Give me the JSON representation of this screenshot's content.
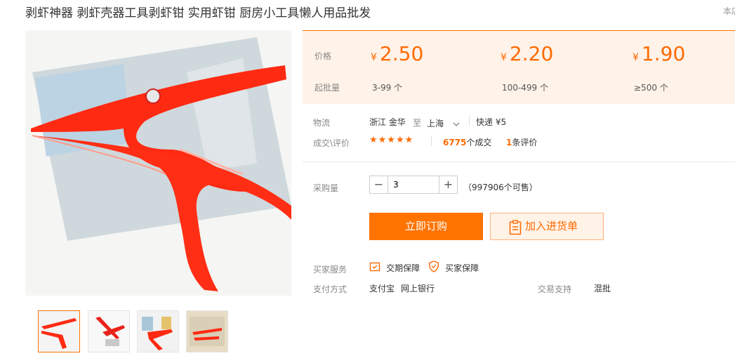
{
  "title": "剥虾神器 剥虾壳器工具剥虾钳 实用虾钳 厨房小工具懒人用品批发",
  "corner_text": "本店",
  "colors": {
    "accent": "#ff7300",
    "price": "#ff6a00",
    "price_bg": "#fff2e8"
  },
  "price_table": {
    "price_label": "价格",
    "moq_label": "起批量",
    "currency": "¥",
    "tiers": [
      {
        "price": "2.50",
        "range": "3-99 个"
      },
      {
        "price": "2.20",
        "range": "100-499 个"
      },
      {
        "price": "1.90",
        "range": "≥500 个"
      }
    ]
  },
  "logistics": {
    "label": "物流",
    "origin": "浙江 金华",
    "to": "至",
    "destination": "上海",
    "shipping": "快递 ¥5"
  },
  "deals": {
    "label": "成交\\评价",
    "stars": "★★★★★",
    "sold_count": "6775",
    "sold_suffix": "个成交",
    "review_count": "1",
    "review_suffix": "条评价"
  },
  "purchase": {
    "label": "采购量",
    "quantity": "3",
    "minus": "−",
    "plus": "+",
    "stock": "（997906个可售）"
  },
  "actions": {
    "buy_now": "立即订购",
    "add_to_cart": "加入进货单"
  },
  "services": {
    "label": "买家服务",
    "items": [
      "交期保障",
      "买家保障"
    ]
  },
  "payment": {
    "label": "支付方式",
    "methods": [
      "支付宝",
      "网上银行"
    ],
    "trade_label": "交易支持",
    "trade_value": "混批"
  }
}
